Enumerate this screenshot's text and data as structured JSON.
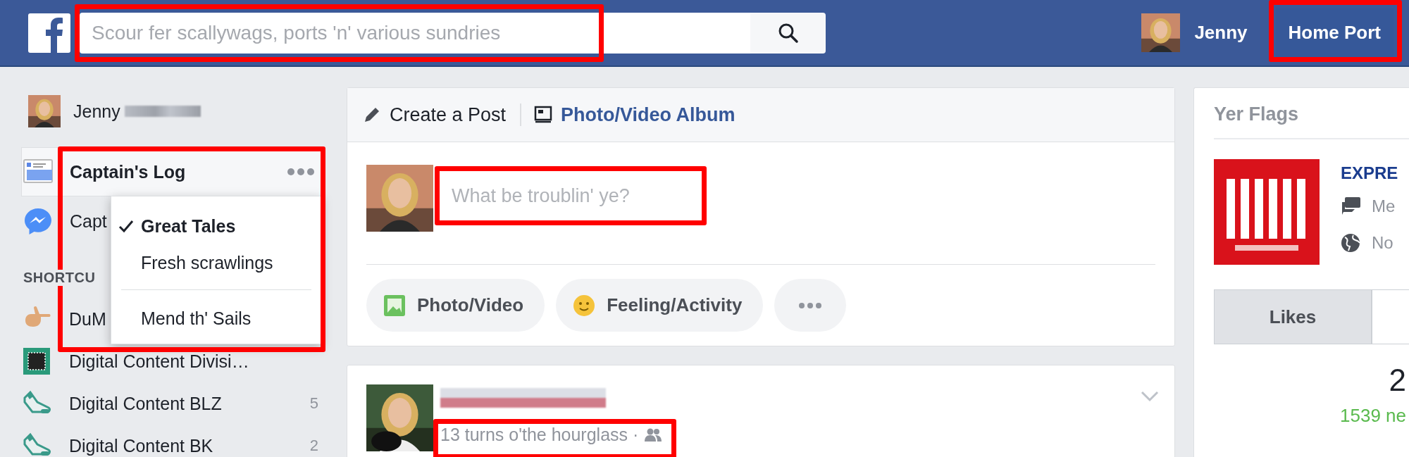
{
  "top_bar": {
    "search": {
      "placeholder": "Scour fer scallywags, ports 'n' various sundries",
      "highlighted": true
    },
    "user": {
      "name": "Jenny"
    },
    "home": {
      "label": "Home Port",
      "highlighted": true
    }
  },
  "sidebar": {
    "user": {
      "name": "Jenny"
    },
    "items": [
      {
        "label": "Captain's Log",
        "selected": true,
        "kind": "feed"
      },
      {
        "label": "Capt",
        "selected": false,
        "kind": "messenger"
      }
    ],
    "menu": {
      "highlighted": true,
      "options": [
        {
          "label": "Great Tales",
          "checked": true,
          "kind": "option"
        },
        {
          "label": "Fresh scrawlings",
          "checked": false,
          "kind": "option"
        },
        {
          "label": "Mend th' Sails",
          "checked": false,
          "kind": "action"
        }
      ]
    },
    "shortcuts": {
      "heading": "SHORTCU",
      "items": [
        {
          "label": "DuM",
          "kind": "hand"
        },
        {
          "label": "Digital Content Divisi…",
          "kind": "chip"
        },
        {
          "label": "Digital Content BLZ",
          "count": "5",
          "kind": "shoe"
        },
        {
          "label": "Digital Content BK",
          "count": "2",
          "kind": "shoe"
        }
      ]
    }
  },
  "composer": {
    "tabs": [
      {
        "label": "Create a Post",
        "selected": true,
        "kind": "post"
      },
      {
        "label": "Photo/Video Album",
        "selected": false,
        "kind": "album"
      }
    ],
    "field": {
      "placeholder": "What be troublin' ye?",
      "highlighted": true
    },
    "actions": [
      {
        "label": "Photo/Video"
      },
      {
        "label": "Feeling/Activity",
        "kind": "feeling"
      },
      {
        "kind": "more"
      }
    ]
  },
  "post": {
    "timestamp": {
      "text": "13 turns o'the hourglass ·",
      "highlighted": true
    }
  },
  "right_panel": {
    "title": "Yer Flags",
    "page": {
      "name": "EXPRE",
      "lines": [
        {
          "kind": "message",
          "text": "Me"
        },
        {
          "kind": "globe",
          "text": "No"
        }
      ]
    },
    "tabs": [
      {
        "label": "Likes",
        "selected": true
      }
    ],
    "count": "2",
    "new_count": "1539 ne"
  }
}
